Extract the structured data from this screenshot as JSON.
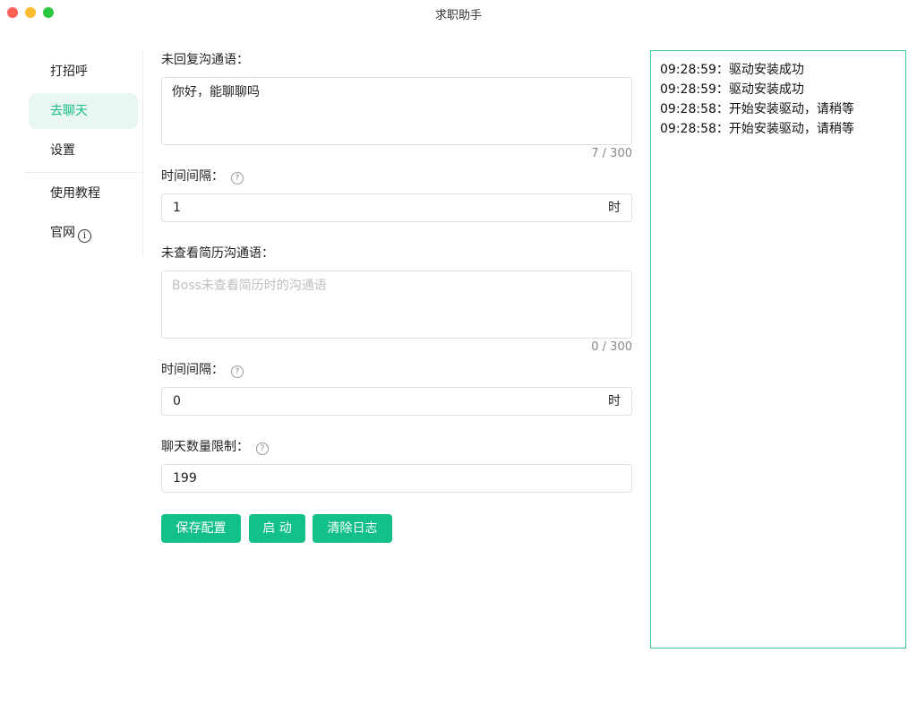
{
  "window": {
    "title": "求职助手"
  },
  "sidebar": {
    "items": [
      {
        "label": "打招呼",
        "active": false
      },
      {
        "label": "去聊天",
        "active": true
      },
      {
        "label": "设置",
        "active": false
      },
      {
        "label": "使用教程",
        "active": false
      },
      {
        "label": "官网",
        "active": false,
        "icon": "info-circle-icon"
      }
    ]
  },
  "form": {
    "unreplied": {
      "label": "未回复沟通语：",
      "value": "你好，能聊聊吗",
      "counter": "7 / 300"
    },
    "interval1": {
      "label": "时间间隔：",
      "value": "1",
      "suffix": "时"
    },
    "unviewed": {
      "label": "未查看简历沟通语：",
      "placeholder": "Boss未查看简历时的沟通语",
      "counter": "0 / 300"
    },
    "interval2": {
      "label": "时间间隔：",
      "value": "0",
      "suffix": "时"
    },
    "chat_limit": {
      "label": "聊天数量限制：",
      "value": "199"
    },
    "help_icon": "question-circle-icon",
    "buttons": {
      "save": "保存配置",
      "start": "启 动",
      "clear": "清除日志"
    }
  },
  "log": {
    "lines": [
      "09:28:59：驱动安装成功",
      "09:28:59：驱动安装成功",
      "09:28:58：开始安装驱动，请稍等",
      "09:28:58：开始安装驱动，请稍等"
    ]
  },
  "colors": {
    "accent": "#13c08a",
    "active_bg": "#e8f8f1",
    "log_border": "#3cc49a"
  }
}
